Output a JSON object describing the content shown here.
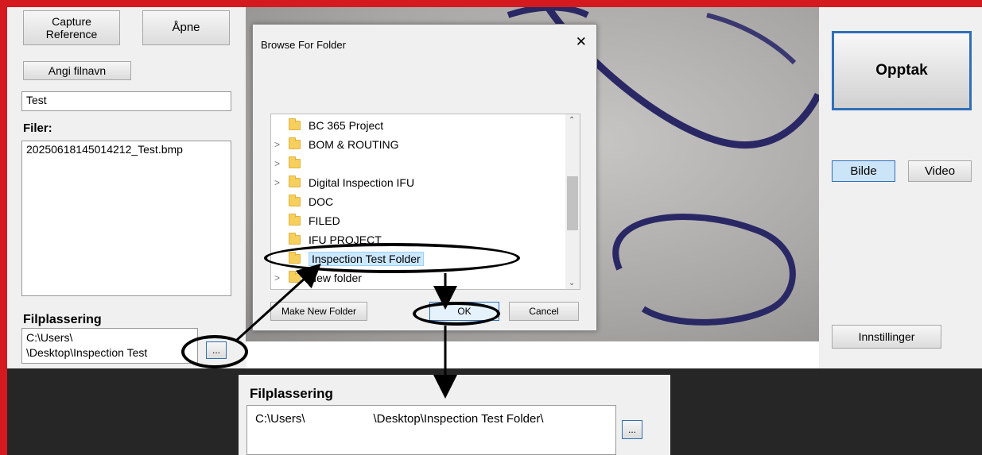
{
  "left": {
    "capture_reference": "Capture\nReference",
    "open": "Åpne",
    "set_filename": "Angi filnavn",
    "filename_value": "Test",
    "files_label": "Filer:",
    "files": [
      "20250618145014212_Test.bmp"
    ],
    "location_label": "Filplassering",
    "location_line1": "C:\\Users\\",
    "location_line2": "\\Desktop\\Inspection Test",
    "browse": "..."
  },
  "right": {
    "record": "Opptak",
    "image": "Bilde",
    "video": "Video",
    "settings": "Innstillinger"
  },
  "dialog": {
    "title": "Browse For Folder",
    "close": "✕",
    "folders": [
      {
        "name": "BC 365 Project",
        "expandable": false
      },
      {
        "name": "BOM & ROUTING",
        "expandable": true
      },
      {
        "name": "",
        "expandable": true
      },
      {
        "name": "Digital Inspection IFU",
        "expandable": true
      },
      {
        "name": "DOC",
        "expandable": false
      },
      {
        "name": "FILED",
        "expandable": false
      },
      {
        "name": "IFU PROJECT",
        "expandable": false
      },
      {
        "name": "Inspection Test Folder",
        "expandable": false,
        "selected": true
      },
      {
        "name": "New folder",
        "expandable": true
      }
    ],
    "make_new_folder": "Make New Folder",
    "ok": "OK",
    "cancel": "Cancel"
  },
  "bottom": {
    "location_label": "Filplassering",
    "path_prefix": "C:\\Users\\",
    "path_suffix": "\\Desktop\\Inspection Test Folder\\",
    "browse": "..."
  },
  "colors": {
    "accent_red": "#d4191f",
    "selection": "#cce8ff",
    "active_blue": "#2f6fb8"
  }
}
